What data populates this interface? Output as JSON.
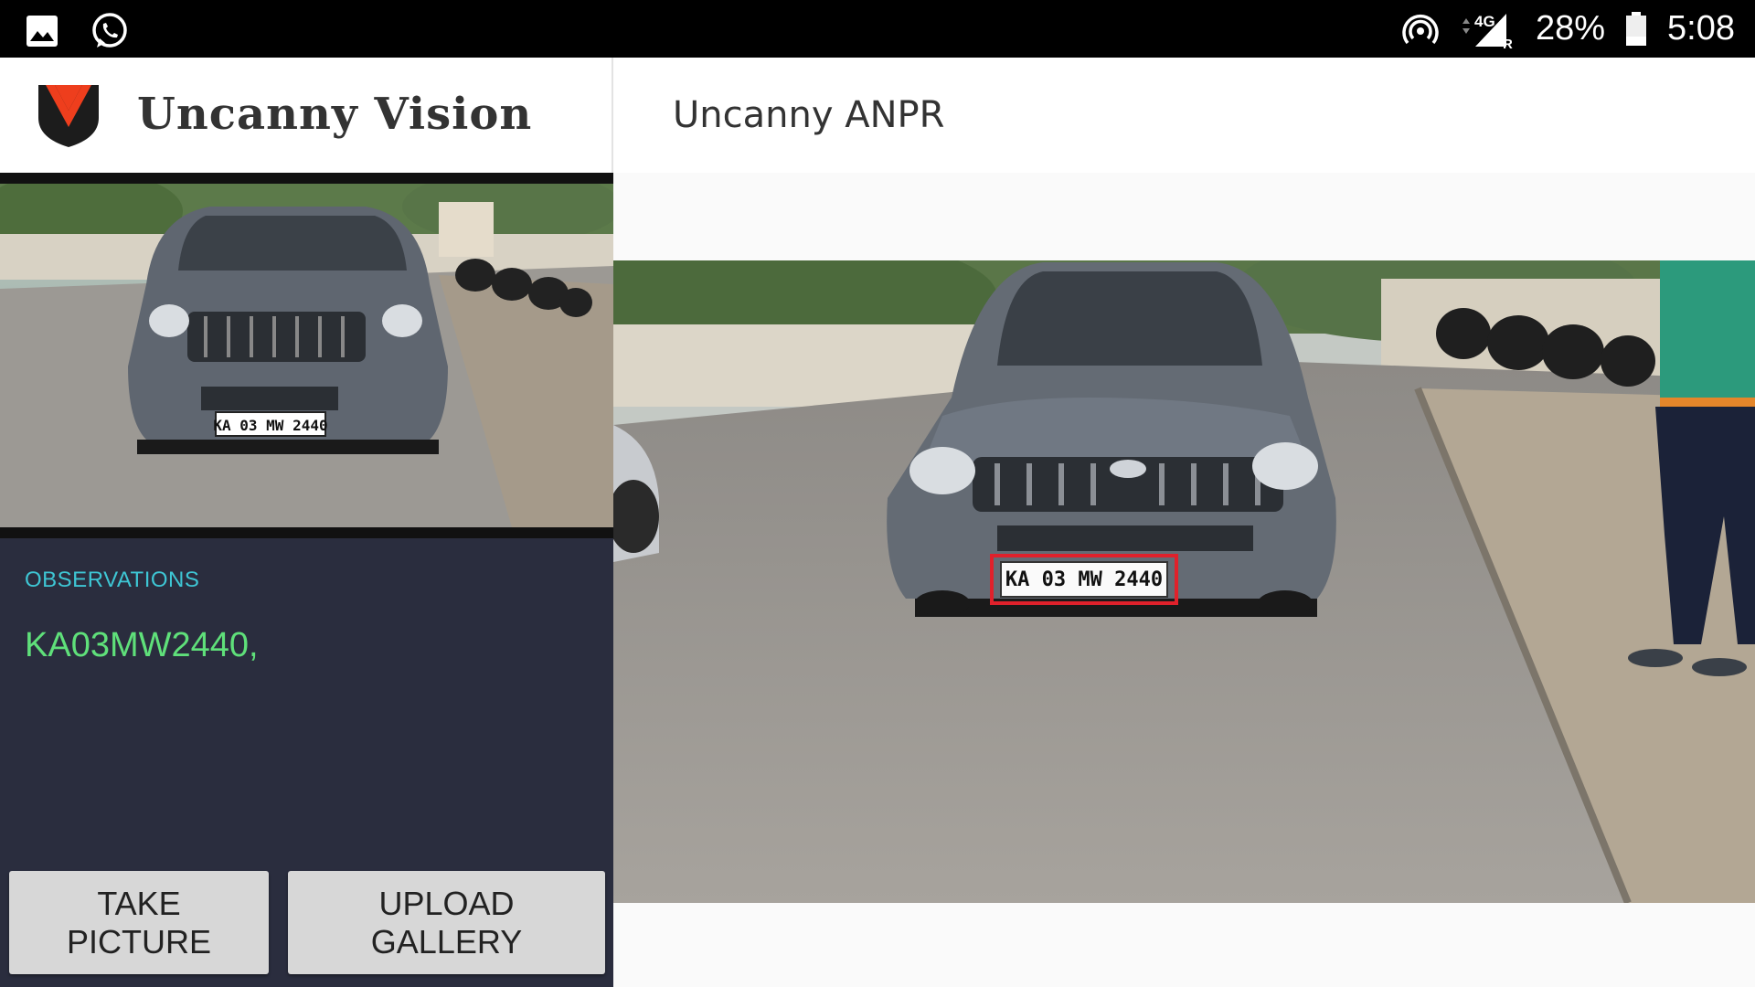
{
  "status_bar": {
    "left_icons": [
      "gallery-icon",
      "whatsapp-icon"
    ],
    "right_icons": [
      "hotspot-icon",
      "signal-icon",
      "battery-icon"
    ],
    "network": "4G",
    "roaming": "R",
    "battery": "28%",
    "time": "5:08"
  },
  "left_panel": {
    "brand": "Uncanny Vision",
    "observations_title": "OBSERVATIONS",
    "observations_value": "KA03MW2440,",
    "buttons": {
      "take_picture": "TAKE\nPICTURE",
      "upload_gallery": "UPLOAD\nGALLERY"
    },
    "thumbnail_plate": "KA 03 MW 2440"
  },
  "right_panel": {
    "title": "Uncanny ANPR",
    "plate_text": "KA 03 MW 2440"
  },
  "colors": {
    "accent_cyan": "#3ec6d4",
    "result_green": "#5fe07a",
    "panel_dark": "#2a2d3e",
    "detection_box": "#e0212b",
    "logo_orange": "#ee3e1d"
  }
}
